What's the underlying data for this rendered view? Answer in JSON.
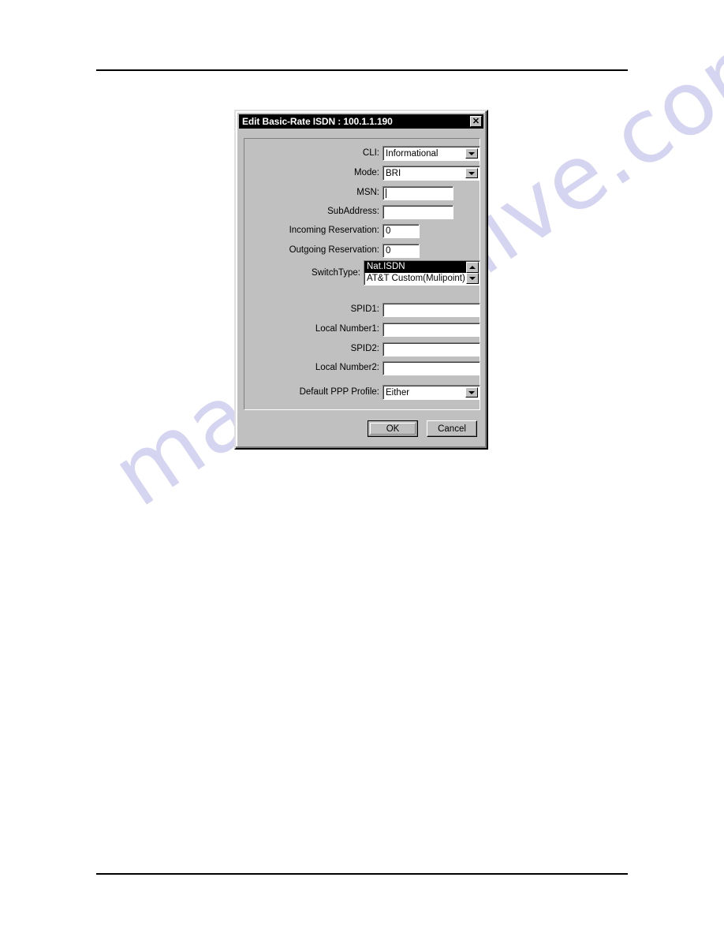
{
  "page": {
    "background": "#ffffff",
    "watermark_text": "manualshive.com",
    "watermark_color": "#d5d5f2"
  },
  "dialog": {
    "title": "Edit Basic-Rate ISDN : 100.1.1.190",
    "close_glyph": "✕",
    "background": "#c0c0c0",
    "titlebar_background": "#000000",
    "fields": {
      "cli": {
        "label": "CLI:",
        "value": "Informational",
        "type": "combobox"
      },
      "mode": {
        "label": "Mode:",
        "value": "BRI",
        "type": "combobox"
      },
      "msn": {
        "label": "MSN:",
        "value": "",
        "type": "textbox",
        "focused": true
      },
      "subaddress": {
        "label": "SubAddress:",
        "value": "",
        "type": "textbox"
      },
      "incoming_reservation": {
        "label": "Incoming Reservation:",
        "value": "0",
        "type": "textbox"
      },
      "outgoing_reservation": {
        "label": "Outgoing Reservation:",
        "value": "0",
        "type": "textbox"
      },
      "switch_type": {
        "label": "SwitchType:",
        "type": "listbox",
        "options": [
          {
            "label": "Nat.ISDN",
            "selected": true
          },
          {
            "label": "AT&T Custom(Mulipoint)",
            "selected": false
          }
        ]
      },
      "spid1": {
        "label": "SPID1:",
        "value": "",
        "type": "textbox"
      },
      "local_number1": {
        "label": "Local Number1:",
        "value": "",
        "type": "textbox"
      },
      "spid2": {
        "label": "SPID2:",
        "value": "",
        "type": "textbox"
      },
      "local_number2": {
        "label": "Local Number2:",
        "value": "",
        "type": "textbox"
      },
      "default_ppp_profile": {
        "label": "Default PPP Profile:",
        "value": "Either",
        "type": "combobox"
      }
    },
    "buttons": {
      "ok": "OK",
      "cancel": "Cancel"
    }
  }
}
